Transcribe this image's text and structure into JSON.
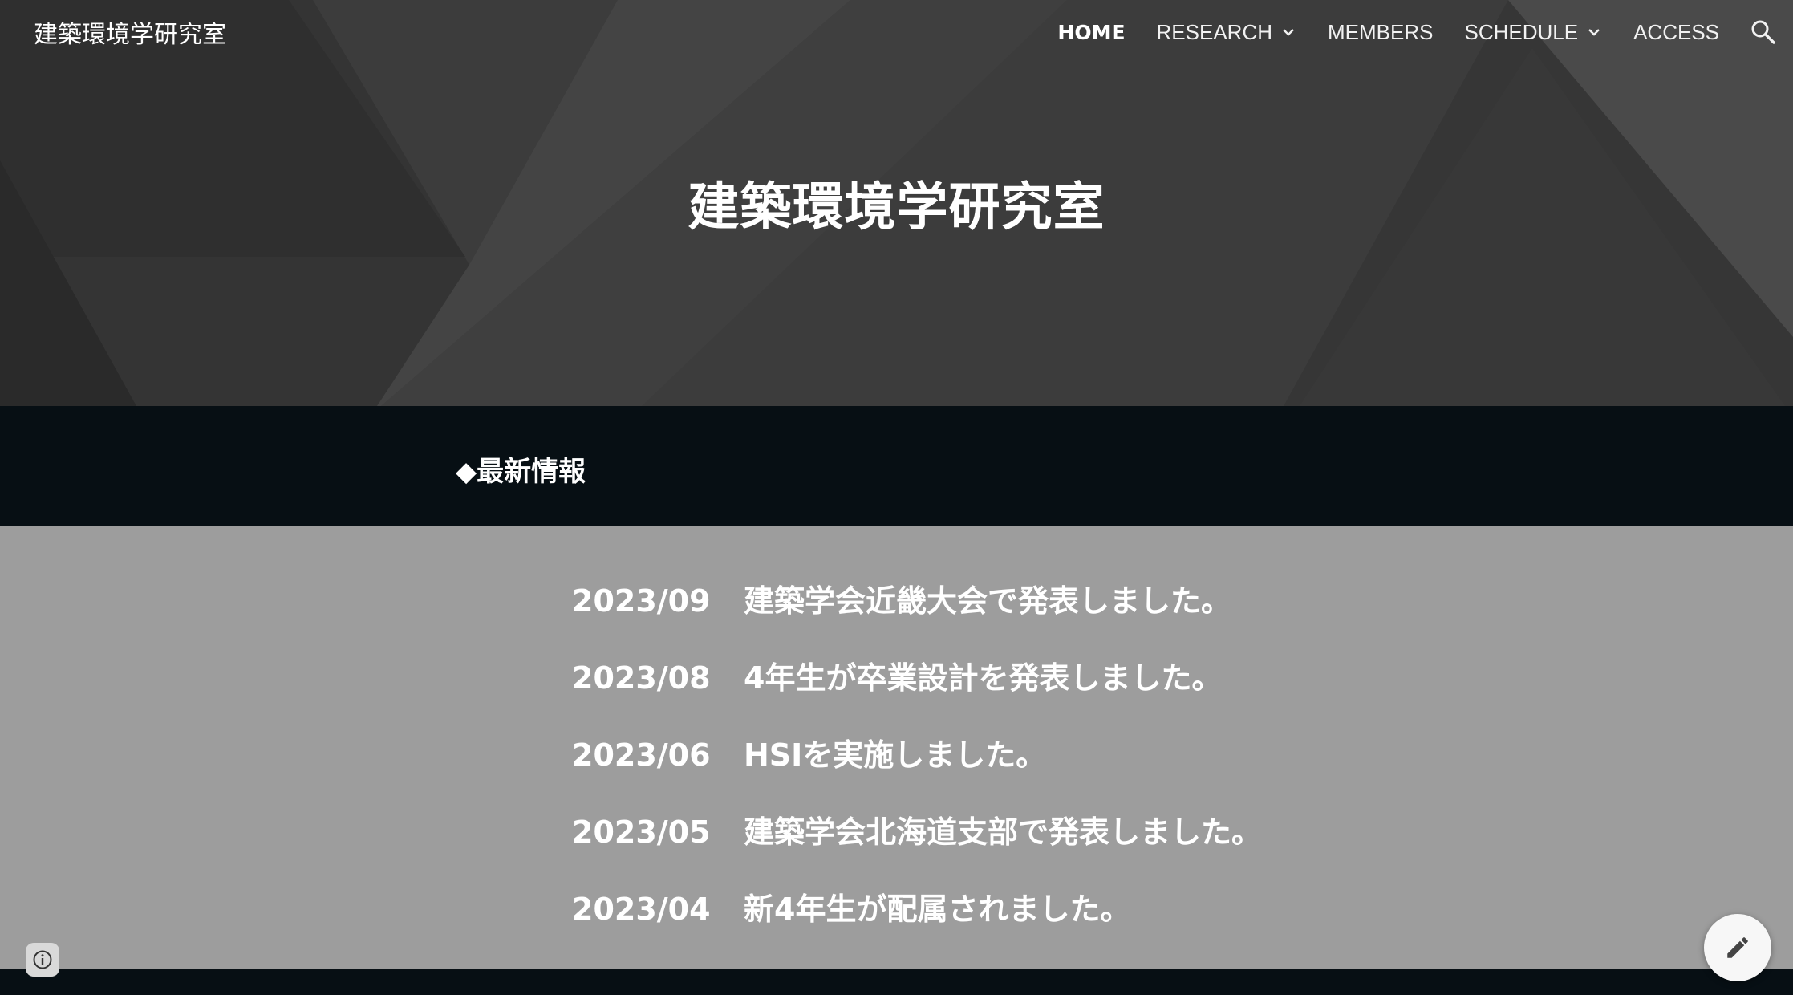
{
  "site": {
    "title": "建築環境学研究室"
  },
  "nav": {
    "items": [
      {
        "label": "HOME",
        "active": true,
        "dropdown": false
      },
      {
        "label": "RESEARCH",
        "active": false,
        "dropdown": true
      },
      {
        "label": "MEMBERS",
        "active": false,
        "dropdown": false
      },
      {
        "label": "SCHEDULE",
        "active": false,
        "dropdown": true
      },
      {
        "label": "ACCESS",
        "active": false,
        "dropdown": false
      }
    ],
    "search_icon": "search-icon"
  },
  "hero": {
    "title": "建築環境学研究室"
  },
  "news": {
    "heading": "◆最新情報",
    "items": [
      {
        "date": "2023/09",
        "text": "建築学会近畿大会で発表しました。"
      },
      {
        "date": "2023/08",
        "text": "4年生が卒業設計を発表しました。"
      },
      {
        "date": "2023/06",
        "text": "HSIを実施しました。"
      },
      {
        "date": "2023/05",
        "text": "建築学会北海道支部で発表しました。"
      },
      {
        "date": "2023/04",
        "text": "新4年生が配属されました。"
      }
    ]
  },
  "floating": {
    "info_icon": "info-icon",
    "edit_icon": "pencil-icon"
  },
  "colors": {
    "hero_bg": "#3d3d3d",
    "dark_band": "#070f14",
    "news_list_bg": "#9d9d9d",
    "text": "#ffffff"
  }
}
